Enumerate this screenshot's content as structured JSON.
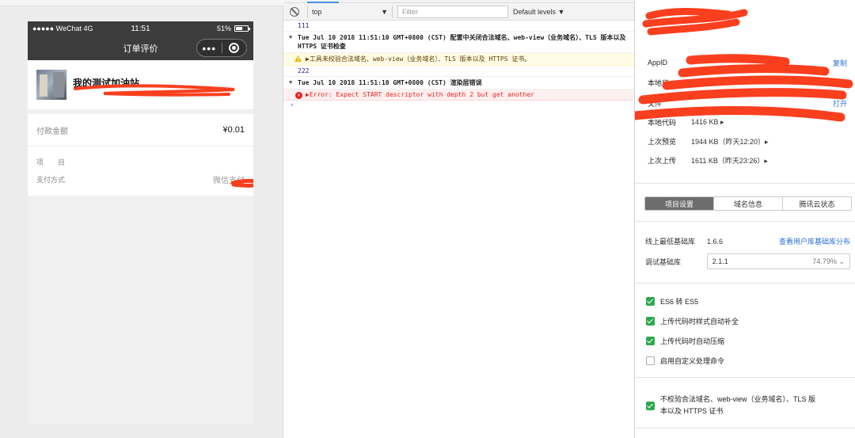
{
  "simulator": {
    "status": {
      "carrier": "●●●●● WeChat 4G",
      "time": "11:51",
      "battery": "51%"
    },
    "nav": {
      "title": "订单评价",
      "more": "•••"
    },
    "store": {
      "name": "我的测试加油站",
      "subtitle": ""
    },
    "amount": {
      "label": "付款金额",
      "value": "¥0.01"
    },
    "details": [
      {
        "label": "项　　目",
        "value": ""
      },
      {
        "label": "支付方式",
        "value": "微信支付"
      }
    ]
  },
  "console": {
    "context": "top",
    "filter_placeholder": "Filter",
    "levels": "Default levels ▼",
    "logs": [
      {
        "kind": "num",
        "text": "111"
      },
      {
        "kind": "group",
        "text": "Tue Jul 10 2018 11:51:10 GMT+0800 (CST) 配置中关闭合法域名、web-view（业务域名）、TLS 版本以及 HTTPS 证书检查"
      },
      {
        "kind": "warn",
        "text": "▶工具未校验合法域名、web-view（业务域名）、TLS 版本以及 HTTPS 证书。"
      },
      {
        "kind": "num",
        "text": "222"
      },
      {
        "kind": "group",
        "text": "Tue Jul 10 2018 11:51:10 GMT+0800 (CST) 渲染层错误"
      },
      {
        "kind": "err",
        "text": "▶Error: Expect START descriptor with depth 2 but get another"
      }
    ]
  },
  "panel": {
    "appid_label": "AppID",
    "copy": "复制",
    "local_label": "本地目",
    "open": "打开",
    "file_label": "文件",
    "open2": "打开",
    "code_label": "本地代码",
    "code_value": "1416 KB ▸",
    "preview_label": "上次预览",
    "preview_value": "1944 KB（昨天12:20）▸",
    "upload_label": "上次上传",
    "upload_value": "1611 KB（昨天23:26）▸",
    "tabs": [
      "项目设置",
      "域名信息",
      "腾讯云状态"
    ],
    "min_lib_label": "线上最低基础库",
    "min_lib_value": "1.6.6",
    "min_lib_link": "查看用户库基础库分布",
    "debug_lib_label": "调试基础库",
    "debug_lib_value": "2.1.1",
    "debug_lib_pct": "74.79% ⌄",
    "checks": [
      {
        "label": "ES6 转 ES5",
        "checked": true
      },
      {
        "label": "上传代码时样式自动补全",
        "checked": true
      },
      {
        "label": "上传代码时自动压缩",
        "checked": true
      },
      {
        "label": "启用自定义处理命令",
        "checked": false
      }
    ],
    "bottom_check_line1": "不校验合法域名、web-view（业务域名）、TLS 版",
    "bottom_check_line2": "本以及 HTTPS 证书",
    "colors": {
      "redaction": "#fa3f1e",
      "check": "#2fa84f",
      "link": "#2a6fd6"
    }
  }
}
